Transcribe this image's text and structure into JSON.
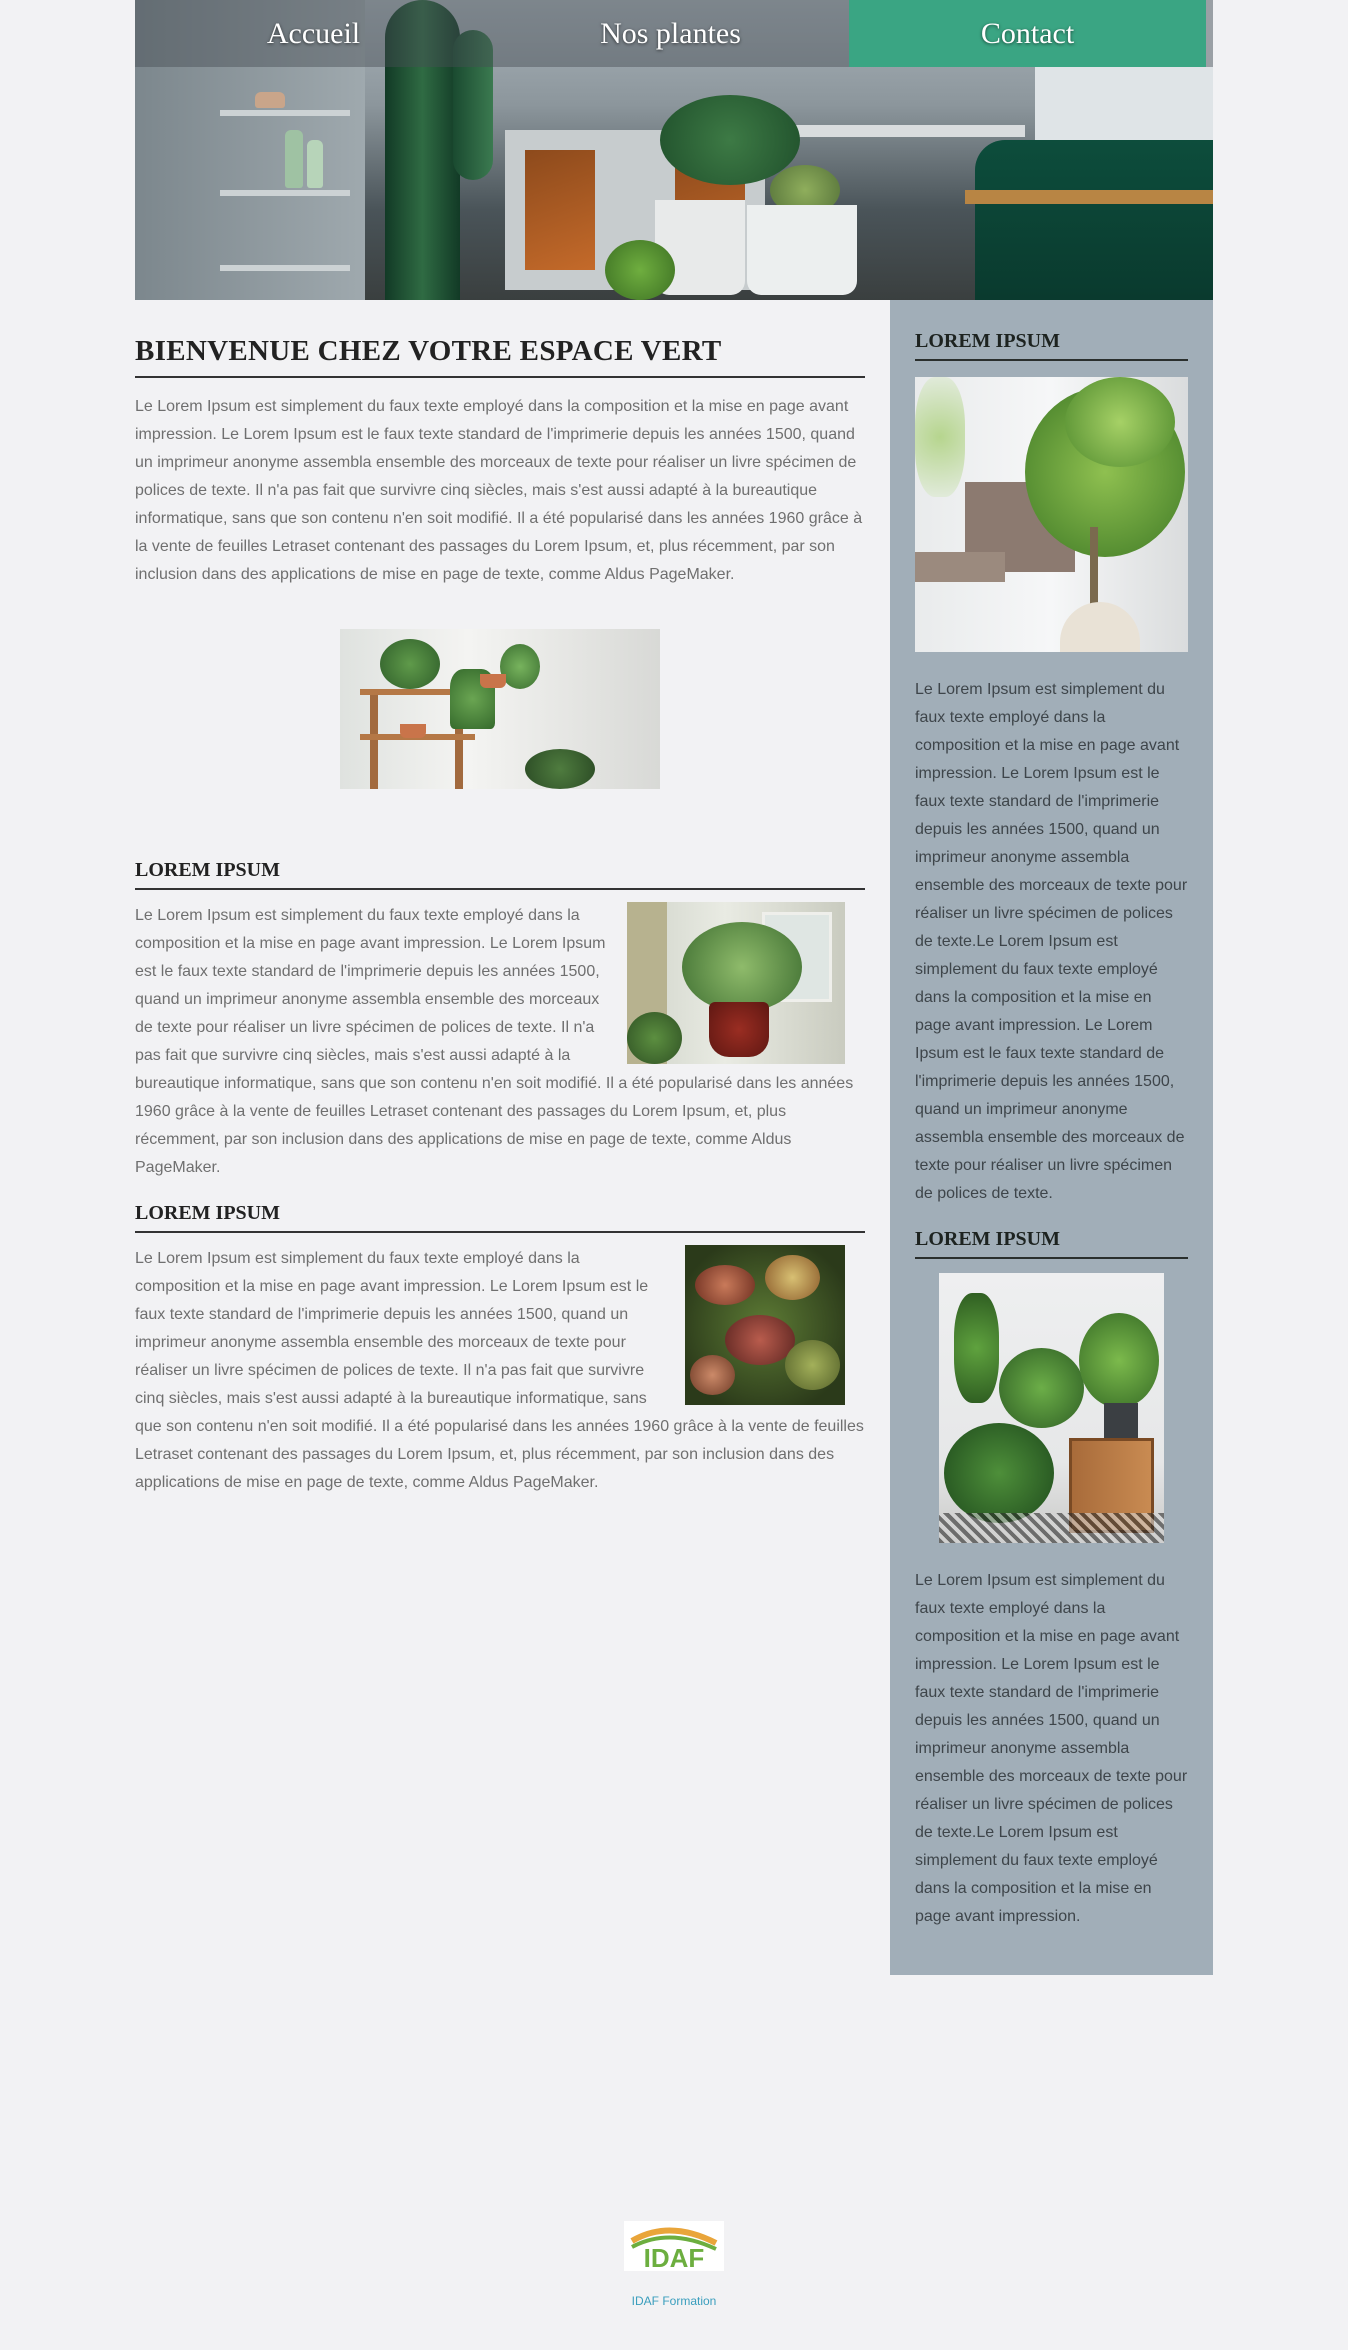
{
  "nav": {
    "items": [
      "Accueil",
      "Nos plantes",
      "Contact"
    ],
    "active_index": 2
  },
  "colors": {
    "accent": "#3aa583",
    "sidebar_bg": "#a1aeb8",
    "page_bg": "#f2f2f4",
    "footer_link": "#3a9ebd"
  },
  "main": {
    "title": "BIENVENUE CHEZ VOTRE ESPACE VERT",
    "intro": "Le Lorem Ipsum est simplement du faux texte employé dans la composition et la mise en page avant impression. Le Lorem Ipsum est le faux texte standard de l'imprimerie depuis les années 1500, quand un imprimeur anonyme assembla ensemble des morceaux de texte pour réaliser un livre spécimen de polices de texte. Il n'a pas fait que survivre cinq siècles, mais s'est aussi adapté à la bureautique informatique, sans que son contenu n'en soit modifié. Il a été popularisé dans les années 1960 grâce à la vente de feuilles Letraset contenant des passages du Lorem Ipsum, et, plus récemment, par son inclusion dans des applications de mise en page de texte, comme Aldus PageMaker.",
    "sections": [
      {
        "title": "LOREM IPSUM",
        "text": "Le Lorem Ipsum est simplement du faux texte employé dans la composition et la mise en page avant impression. Le Lorem Ipsum est le faux texte standard de l'imprimerie depuis les années 1500, quand un imprimeur anonyme assembla ensemble des morceaux de texte pour réaliser un livre spécimen de polices de texte. Il n'a pas fait que survivre cinq siècles, mais s'est aussi adapté à la bureautique informatique, sans que son contenu n'en soit modifié. Il a été popularisé dans les années 1960 grâce à la vente de feuilles Letraset contenant des passages du Lorem Ipsum, et, plus récemment, par son inclusion dans des applications de mise en page de texte, comme Aldus PageMaker."
      },
      {
        "title": "LOREM IPSUM",
        "text": "Le Lorem Ipsum est simplement du faux texte employé dans la composition et la mise en page avant impression. Le Lorem Ipsum est le faux texte standard de l'imprimerie depuis les années 1500, quand un imprimeur anonyme assembla ensemble des morceaux de texte pour réaliser un livre spécimen de polices de texte. Il n'a pas fait que survivre cinq siècles, mais s'est aussi adapté à la bureautique informatique, sans que son contenu n'en soit modifié. Il a été popularisé dans les années 1960 grâce à la vente de feuilles Letraset contenant des passages du Lorem Ipsum, et, plus récemment, par son inclusion dans des applications de mise en page de texte, comme Aldus PageMaker."
      }
    ]
  },
  "sidebar": {
    "blocks": [
      {
        "title": "LOREM IPSUM",
        "text": "Le Lorem Ipsum est simplement du faux texte employé dans la composition et la mise en page avant impression. Le Lorem Ipsum est le faux texte standard de l'imprimerie depuis les années 1500, quand un imprimeur anonyme assembla ensemble des morceaux de texte pour réaliser un livre spécimen de polices de texte.Le Lorem Ipsum est simplement du faux texte employé dans la composition et la mise en page avant impression. Le Lorem Ipsum est le faux texte standard de l'imprimerie depuis les années 1500, quand un imprimeur anonyme assembla ensemble des morceaux de texte pour réaliser un livre spécimen de polices de texte."
      },
      {
        "title": "LOREM IPSUM",
        "text": "Le Lorem Ipsum est simplement du faux texte employé dans la composition et la mise en page avant impression. Le Lorem Ipsum est le faux texte standard de l'imprimerie depuis les années 1500, quand un imprimeur anonyme assembla ensemble des morceaux de texte pour réaliser un livre spécimen de polices de texte.Le Lorem Ipsum est simplement du faux texte employé dans la composition et la mise en page avant impression."
      }
    ]
  },
  "footer": {
    "logo_text": "IDAF",
    "link_text": "IDAF Formation"
  }
}
